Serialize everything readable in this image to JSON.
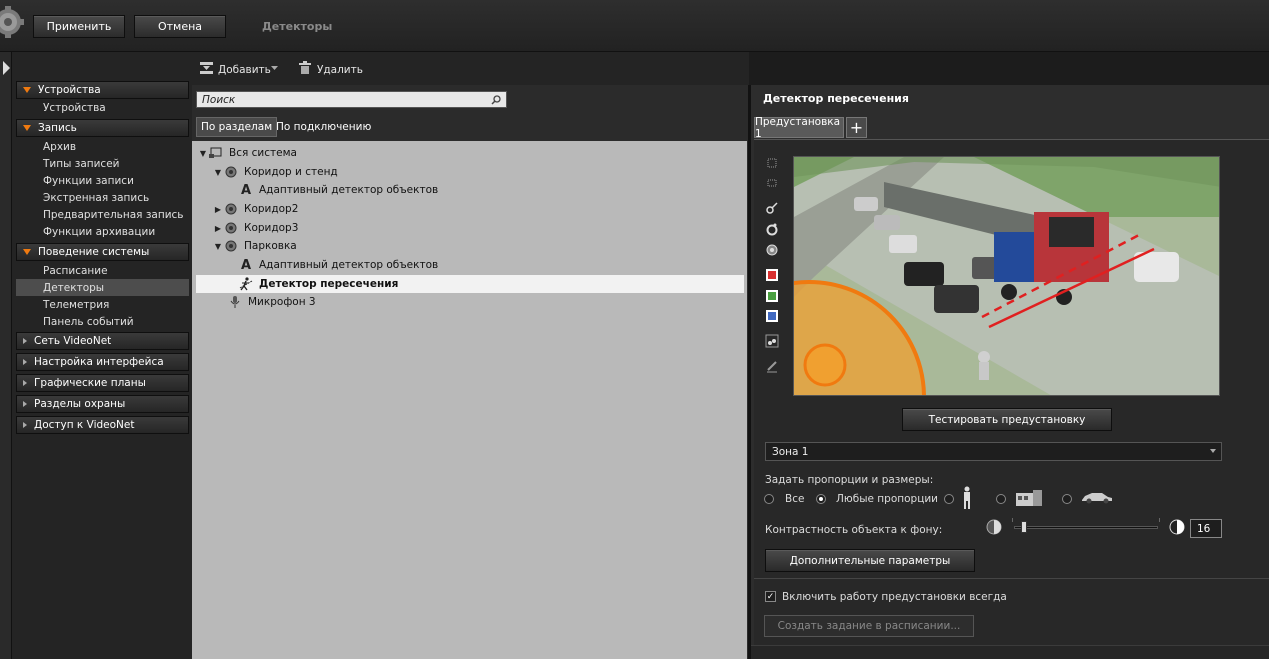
{
  "topbar": {
    "apply": "Применить",
    "cancel": "Отмена",
    "breadcrumb": "Детекторы"
  },
  "sidebar": {
    "sections": [
      {
        "label": "Устройства",
        "expanded": true,
        "items": [
          "Устройства"
        ]
      },
      {
        "label": "Запись",
        "expanded": true,
        "items": [
          "Архив",
          "Типы записей",
          "Функции записи",
          "Экстренная запись",
          "Предварительная запись",
          "Функции архивации"
        ]
      },
      {
        "label": "Поведение системы",
        "expanded": true,
        "items": [
          "Расписание",
          "Детекторы",
          "Телеметрия",
          "Панель событий"
        ]
      },
      {
        "label": "Сеть VideoNet",
        "expanded": false,
        "items": []
      },
      {
        "label": "Настройка интерфейса",
        "expanded": false,
        "items": []
      },
      {
        "label": "Графические планы",
        "expanded": false,
        "items": []
      },
      {
        "label": "Разделы охраны",
        "expanded": false,
        "items": []
      },
      {
        "label": "Доступ к VideoNet",
        "expanded": false,
        "items": []
      }
    ],
    "selected": "Детекторы"
  },
  "toolbar": {
    "add": "Добавить",
    "delete": "Удалить"
  },
  "search": {
    "placeholder": "Поиск"
  },
  "view_tabs": {
    "by_section": "По разделам",
    "by_connection": "По подключению"
  },
  "tree": [
    {
      "label": "Вся система",
      "arrow": "down",
      "icon": "system-icon"
    },
    {
      "label": "Коридор и стенд",
      "arrow": "down",
      "icon": "camera-icon"
    },
    {
      "label": "Адаптивный детектор объектов",
      "arrow": "",
      "icon": "adaptive-detector-icon"
    },
    {
      "label": "Коридор2",
      "arrow": "right",
      "icon": "camera-icon"
    },
    {
      "label": "Коридор3",
      "arrow": "right",
      "icon": "camera-icon"
    },
    {
      "label": "Парковка",
      "arrow": "down",
      "icon": "camera-icon"
    },
    {
      "label": "Адаптивный детектор объектов",
      "arrow": "",
      "icon": "adaptive-detector-icon"
    },
    {
      "label": "Детектор пересечения",
      "arrow": "",
      "icon": "crossing-detector-icon"
    },
    {
      "label": "Микрофон 3",
      "arrow": "",
      "icon": "microphone-icon"
    }
  ],
  "detector": {
    "title": "Детектор пересечения",
    "preset_tab": "Предустановка 1",
    "test_button": "Тестировать предустановку",
    "zone_selected": "Зона 1",
    "proportions_label": "Задать пропорции и размеры:",
    "radio_all": "Все",
    "radio_any": "Любые пропорции",
    "selected_radio": "Любые пропорции",
    "contrast_label": "Контрастность объекта к фону:",
    "contrast_value": "16",
    "contrast_fraction": 0.05,
    "extra_params_button": "Дополнительные параметры",
    "enable_always_label": "Включить работу предустановки всегда",
    "enable_always_checked": true,
    "create_task_button": "Создать задание в расписании..."
  },
  "colors": {
    "accent": "#f07a10",
    "selection": "#4d4d4d",
    "tree_bg": "#b9b9b9"
  }
}
